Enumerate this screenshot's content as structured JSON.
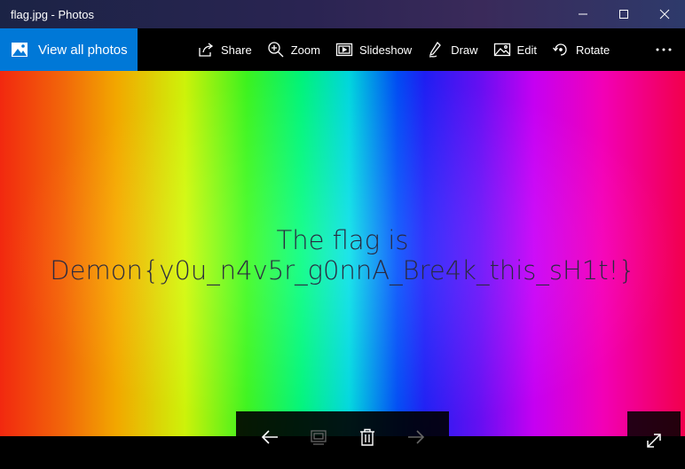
{
  "window": {
    "title": "flag.jpg - Photos"
  },
  "toolbar": {
    "view_all_label": "View all photos",
    "items": [
      {
        "label": "Share",
        "icon": "share-icon"
      },
      {
        "label": "Zoom",
        "icon": "zoom-icon"
      },
      {
        "label": "Slideshow",
        "icon": "slideshow-icon"
      },
      {
        "label": "Draw",
        "icon": "pen-icon"
      },
      {
        "label": "Edit",
        "icon": "edit-photo-icon"
      },
      {
        "label": "Rotate",
        "icon": "rotate-icon"
      }
    ],
    "more_icon": "more-icon"
  },
  "image": {
    "line1": "The flag is",
    "line2": "Demon{y0u_n4v5r_g0nnA_Bre4k_this_sH1t!}"
  },
  "controls": {
    "icons": [
      "back-arrow-icon",
      "add-to-album-icon",
      "delete-icon",
      "forward-arrow-icon",
      "expand-icon"
    ]
  },
  "colors": {
    "accent": "#0078d7",
    "text_on_image": "#2a2a40"
  }
}
